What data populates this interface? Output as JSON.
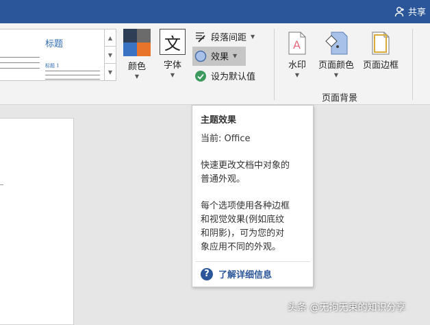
{
  "titlebar": {
    "share_label": "共享"
  },
  "gallery": {
    "title": "标题",
    "heading1": "标题 1"
  },
  "ribbon": {
    "colors_label": "颜色",
    "fonts_label": "字体",
    "font_glyph": "文",
    "paragraph_spacing_label": "段落间距",
    "effects_label": "效果",
    "set_default_label": "设为默认值",
    "watermark_label": "水印",
    "page_color_label": "页面颜色",
    "page_borders_label": "页面边框",
    "group_label": "页面背景",
    "theme_colors": [
      "#2e3e55",
      "#6b6b6b",
      "#3a73c2",
      "#e8742c"
    ]
  },
  "tooltip": {
    "title": "主题效果",
    "current": "当前: Office",
    "line1a": "快速更改文档中对象的",
    "line1b": "普通外观。",
    "line2a": "每个选项使用各种边框",
    "line2b": "和视觉效果(例如底纹",
    "line2c": "和阴影)，可为您的对",
    "line2d": "象应用不同的外观。",
    "learn_more": "了解详细信息"
  },
  "watermark_text": "头条 @无拘无束的知识分享"
}
